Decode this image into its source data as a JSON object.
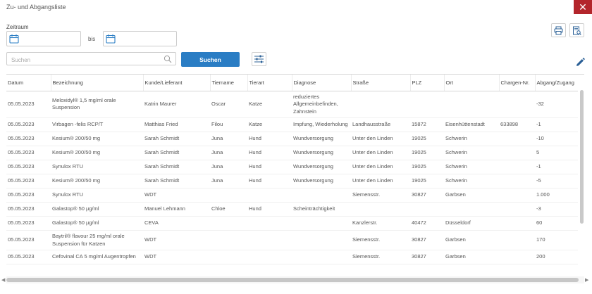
{
  "window": {
    "title": "Zu- und Abgangsliste",
    "close_symbol": "✕",
    "accent": "#b3252b"
  },
  "filters": {
    "zeitraum_label": "Zeitraum",
    "bis_label": "bis",
    "date_from": "",
    "date_to": "",
    "search_placeholder": "Suchen",
    "search_value": "",
    "search_button": "Suchen",
    "search_button_color": "#2a7dc4"
  },
  "table": {
    "columns": [
      "Datum",
      "Bezeichnung",
      "Kunde/Lieferant",
      "Tiername",
      "Tierart",
      "Diagnose",
      "Straße",
      "PLZ",
      "Ort",
      "Chargen-Nr.",
      "Abgang/Zugang"
    ],
    "rows": [
      [
        "05.05.2023",
        "Meloxidyl® 1,5 mg/ml orale Suspension",
        "Katrin Maurer",
        "Oscar",
        "Katze",
        "reduziertes Allgemeinbefinden, Zahnstein",
        "",
        "",
        "",
        "",
        "-32"
      ],
      [
        "05.05.2023",
        "Virbagen -felis RCP/T",
        "Matthias Fried",
        "Filou",
        "Katze",
        "Impfung, Wiederholung",
        "Landhausstraße",
        "15872",
        "Eisenhüttenstadt",
        "633898",
        "-1"
      ],
      [
        "05.05.2023",
        "Kesium® 200/50 mg",
        "Sarah Schmidt",
        "Juna",
        "Hund",
        "Wundversorgung",
        "Unter den Linden",
        "19025",
        "Schwerin",
        "",
        "-10"
      ],
      [
        "05.05.2023",
        "Kesium® 200/50 mg",
        "Sarah Schmidt",
        "Juna",
        "Hund",
        "Wundversorgung",
        "Unter den Linden",
        "19025",
        "Schwerin",
        "",
        "5"
      ],
      [
        "05.05.2023",
        "Synulox RTU",
        "Sarah Schmidt",
        "Juna",
        "Hund",
        "Wundversorgung",
        "Unter den Linden",
        "19025",
        "Schwerin",
        "",
        "-1"
      ],
      [
        "05.05.2023",
        "Kesium® 200/50 mg",
        "Sarah Schmidt",
        "Juna",
        "Hund",
        "Wundversorgung",
        "Unter den Linden",
        "19025",
        "Schwerin",
        "",
        "-5"
      ],
      [
        "05.05.2023",
        "Synulox RTU",
        "WDT",
        "",
        "",
        "",
        "Siemensstr.",
        "30827",
        "Garbsen",
        "",
        "1.000"
      ],
      [
        "05.05.2023",
        "Galastop® 50 µg/ml",
        "Manuel Lehmann",
        "Chloe",
        "Hund",
        "Scheinträchtigkeit",
        "",
        "",
        "",
        "",
        "-3"
      ],
      [
        "05.05.2023",
        "Galastop® 50 µg/ml",
        "CEVA",
        "",
        "",
        "",
        "Kanzlerstr.",
        "40472",
        "Düsseldorf",
        "",
        "60"
      ],
      [
        "05.05.2023",
        "Baytril® flavour 25 mg/ml orale Suspension für Katzen",
        "WDT",
        "",
        "",
        "",
        "Siemensstr.",
        "30827",
        "Garbsen",
        "",
        "170"
      ],
      [
        "05.05.2023",
        "Cefovinal CA 5 mg/ml Augentropfen",
        "WDT",
        "",
        "",
        "",
        "Siemensstr.",
        "30827",
        "Garbsen",
        "",
        "200"
      ]
    ]
  }
}
